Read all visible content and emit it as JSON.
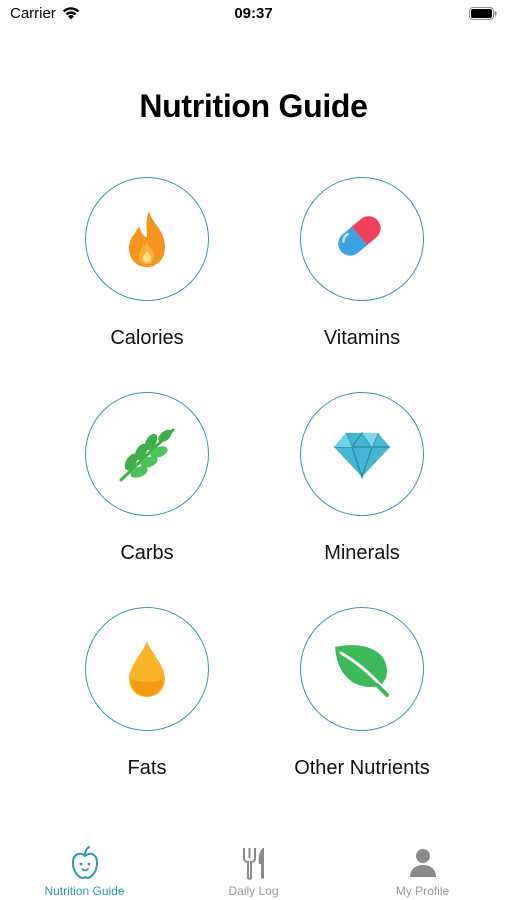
{
  "status_bar": {
    "carrier": "Carrier",
    "time": "09:37"
  },
  "page": {
    "title": "Nutrition Guide"
  },
  "categories": [
    {
      "label": "Calories",
      "icon": "fire-icon"
    },
    {
      "label": "Vitamins",
      "icon": "pill-icon"
    },
    {
      "label": "Carbs",
      "icon": "wheat-icon"
    },
    {
      "label": "Minerals",
      "icon": "diamond-icon"
    },
    {
      "label": "Fats",
      "icon": "oil-drop-icon"
    },
    {
      "label": "Other Nutrients",
      "icon": "leaf-icon"
    }
  ],
  "tabs": [
    {
      "label": "Nutrition Guide",
      "icon": "apple-icon",
      "active": true
    },
    {
      "label": "Daily Log",
      "icon": "fork-knife-icon",
      "active": false
    },
    {
      "label": "My Profile",
      "icon": "person-icon",
      "active": false
    }
  ],
  "colors": {
    "accent": "#2f97ad",
    "circle_border": "#3a97ad",
    "inactive_tab": "#9a9a9a"
  }
}
